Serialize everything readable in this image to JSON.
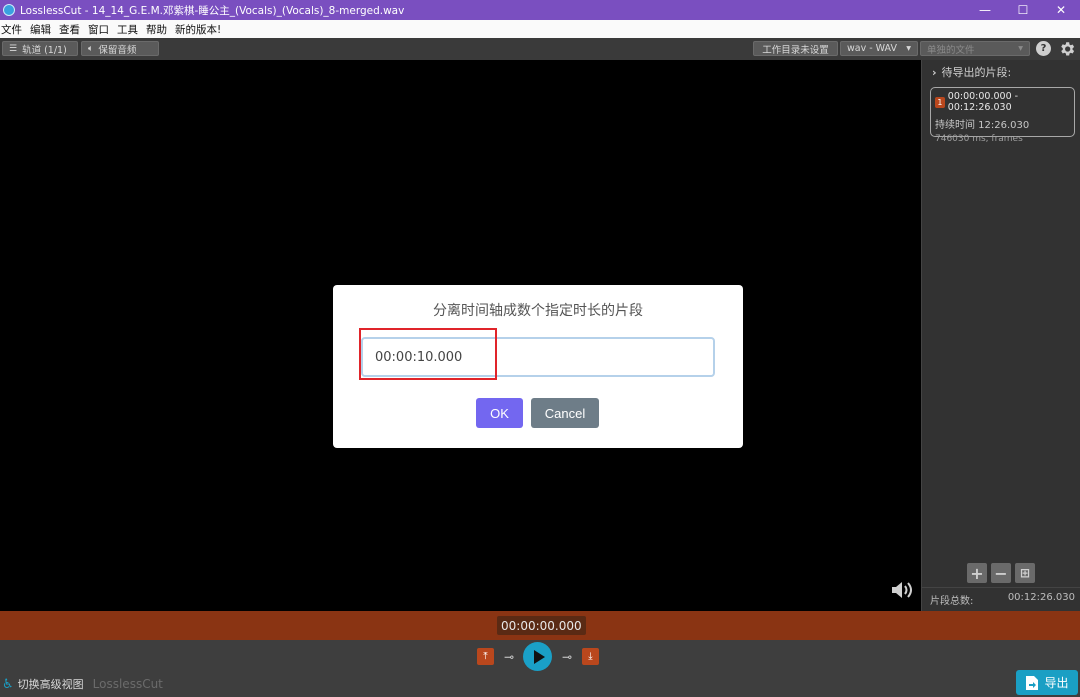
{
  "window": {
    "title": "LosslessCut - 14_14_G.E.M.邓紫棋-睡公主_(Vocals)_(Vocals)_8-merged.wav",
    "controls": [
      "—",
      "☐",
      "✕"
    ]
  },
  "menubar": {
    "items": [
      "文件",
      "编辑",
      "查看",
      "窗口",
      "工具",
      "帮助",
      "新的版本!"
    ]
  },
  "toolbar": {
    "tracks_label": "轨道 (1/1)",
    "keep_audio_label": "保留音频",
    "working_dir_label": "工作目录未设置",
    "format_value": "wav - WAV",
    "output_mode_value": "单独的文件",
    "help_label": "?"
  },
  "sidebar": {
    "header": "待导出的片段:",
    "segments": [
      {
        "index": "1",
        "range": "00:00:00.000 - 00:12:26.030",
        "duration": "持续时间 12:26.030",
        "frames": "746030 ms, frames"
      }
    ],
    "total_label": "片段总数:",
    "total_value": "00:12:26.030"
  },
  "timeline": {
    "current_time": "00:00:00.000"
  },
  "bottom": {
    "toggle_advanced_label": "切换高级视图",
    "brand": "LosslessCut",
    "export_label": "导出"
  },
  "dialog": {
    "title": "分离时间轴成数个指定时长的片段",
    "input_value": "00:00:10.000",
    "ok_label": "OK",
    "cancel_label": "Cancel"
  },
  "colors": {
    "titlebar": "#7a4fc0",
    "timeline": "#8a3413",
    "accent": "#1aa0c7",
    "ok_button": "#7367f0",
    "cancel_button": "#6e7d88",
    "highlight": "#e0242a"
  }
}
